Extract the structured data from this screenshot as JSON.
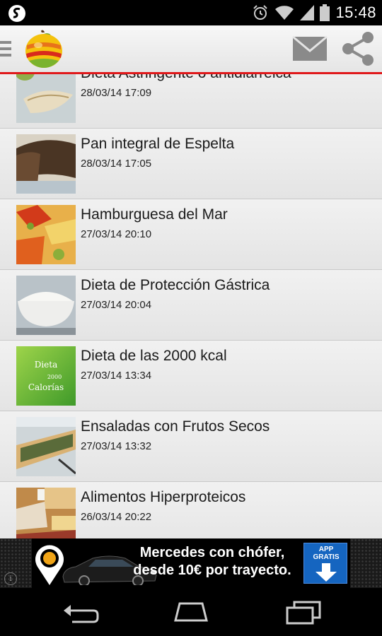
{
  "status_bar": {
    "time": "15:48",
    "icons": [
      "app-notification-icon",
      "alarm-icon",
      "wifi-icon",
      "signal-icon",
      "battery-icon"
    ]
  },
  "action_bar": {
    "icons": [
      "menu-icon",
      "app-logo",
      "mail-icon",
      "share-icon"
    ],
    "accent_color": "#e0191b"
  },
  "recipes": [
    {
      "title": "Dieta Astringente o antidiarreica",
      "date": "28/03/14 17:09",
      "thumb": "fish-fillet-photo"
    },
    {
      "title": "Pan integral de Espelta",
      "date": "28/03/14 17:05",
      "thumb": "bread-photo"
    },
    {
      "title": "Hamburguesa del Mar",
      "date": "27/03/14 20:10",
      "thumb": "seafood-burger-photo"
    },
    {
      "title": "Dieta de Protección Gástrica",
      "date": "27/03/14 20:04",
      "thumb": "rice-bowl-photo"
    },
    {
      "title": "Dieta de las 2000 kcal",
      "date": "27/03/14 13:34",
      "thumb": "green-diet-card",
      "thumb_text": [
        "Dieta",
        "2000",
        "Calorías"
      ]
    },
    {
      "title": "Ensaladas con Frutos Secos",
      "date": "27/03/14 13:32",
      "thumb": "tart-photo"
    },
    {
      "title": "Alimentos Hiperproteicos",
      "date": "26/03/14 20:22",
      "thumb": "protein-foods-photo"
    }
  ],
  "ad": {
    "line1": "Mercedes con chófer,",
    "line2": "desde 10€ por trayecto.",
    "badge_line1": "APP",
    "badge_line2": "GRATIS",
    "info_symbol": "i"
  },
  "nav_bar": {
    "icons": [
      "back-icon",
      "home-icon",
      "recent-apps-icon"
    ]
  }
}
